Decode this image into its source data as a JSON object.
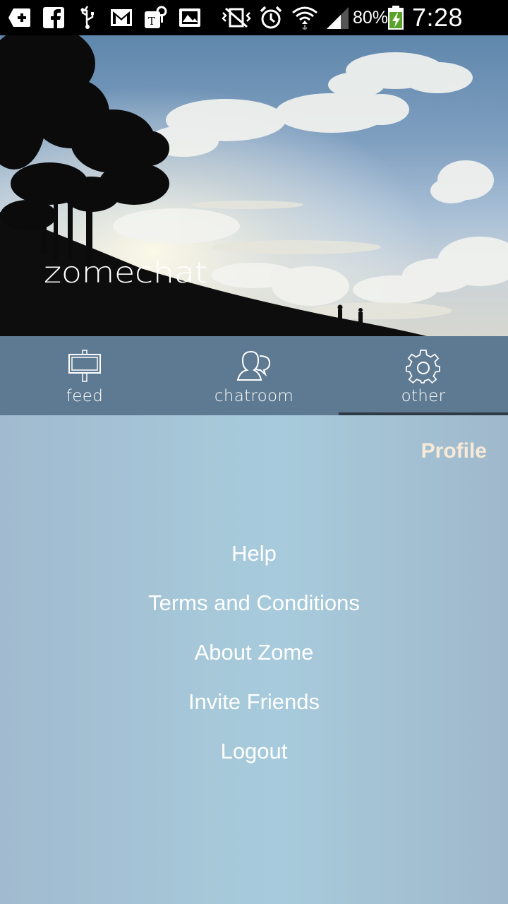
{
  "status_bar": {
    "battery_percent": "80%",
    "time": "7:28 PM",
    "icons": [
      "add-box-icon",
      "facebook-icon",
      "usb-icon",
      "gmail-icon",
      "tmobile-lock-icon",
      "photo-mail-icon",
      "vibrate-off-icon",
      "alarm-icon",
      "wifi-icon",
      "signal-icon",
      "battery-charging-icon"
    ]
  },
  "hero": {
    "brand": "zomechat"
  },
  "tabs": [
    {
      "label": "feed",
      "icon": "signboard-icon",
      "active": false
    },
    {
      "label": "chatroom",
      "icon": "chat-person-icon",
      "active": false
    },
    {
      "label": "other",
      "icon": "gear-icon",
      "active": true
    }
  ],
  "content": {
    "profile_label": "Profile",
    "menu": [
      {
        "label": "Help"
      },
      {
        "label": "Terms and Conditions"
      },
      {
        "label": "About Zome"
      },
      {
        "label": "Invite Friends"
      },
      {
        "label": "Logout"
      }
    ]
  },
  "colors": {
    "tab_bar": "#5e7a92",
    "tab_indicator": "#2e3a45",
    "profile": "#f8ead6",
    "menu_text": "#ffffff"
  }
}
